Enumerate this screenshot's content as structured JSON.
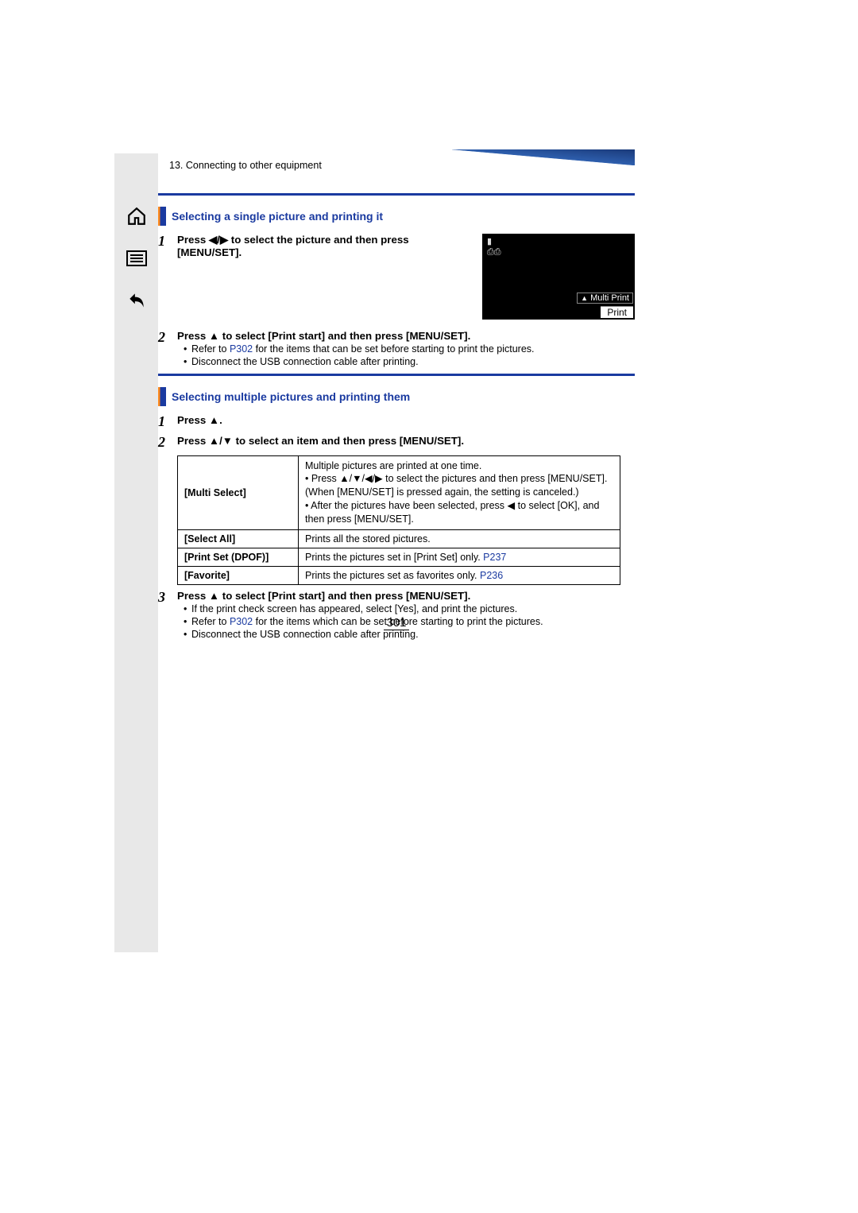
{
  "chapter": "13. Connecting to other equipment",
  "section1": {
    "title": "Selecting a single picture and printing it",
    "steps": [
      {
        "num": "1",
        "title": "Press ◀/▶ to select the picture and then press [MENU/SET]."
      },
      {
        "num": "2",
        "title": "Press ▲ to select [Print start] and then press [MENU/SET].",
        "bullets": [
          {
            "pre": "Refer to ",
            "link": "P302",
            "post": " for the items that can be set before starting to print the pictures."
          },
          {
            "text": "Disconnect the USB connection cable after printing."
          }
        ]
      }
    ],
    "preview": {
      "multi_print": "Multi Print",
      "print": "Print"
    }
  },
  "section2": {
    "title": "Selecting multiple pictures and printing them",
    "steps_intro": [
      {
        "num": "1",
        "title": "Press ▲."
      },
      {
        "num": "2",
        "title": "Press ▲/▼ to select an item and then press [MENU/SET]."
      }
    ],
    "table": [
      {
        "key": "[Multi Select]",
        "desc": [
          "Multiple pictures are printed at one time.",
          "• Press ▲/▼/◀/▶ to select the pictures and then press [MENU/SET].",
          "  (When [MENU/SET] is pressed again, the setting is canceled.)",
          "• After the pictures have been selected, press ◀ to select [OK], and then press [MENU/SET]."
        ]
      },
      {
        "key": "[Select All]",
        "desc_text": "Prints all the stored pictures."
      },
      {
        "key": "[Print Set (DPOF)]",
        "desc_pre": "Prints the pictures set in [Print Set] only. ",
        "desc_link": "P237"
      },
      {
        "key": "[Favorite]",
        "desc_pre": "Prints the pictures set as favorites only. ",
        "desc_link": "P236"
      }
    ],
    "step3": {
      "num": "3",
      "title": "Press ▲ to select [Print start] and then press [MENU/SET].",
      "bullets": [
        {
          "text": "If the print check screen has appeared, select [Yes], and print the pictures."
        },
        {
          "pre": "Refer to ",
          "link": "P302",
          "post": " for the items which can be set before starting to print the pictures."
        },
        {
          "text": "Disconnect the USB connection cable after printing."
        }
      ]
    }
  },
  "page_number": "301"
}
